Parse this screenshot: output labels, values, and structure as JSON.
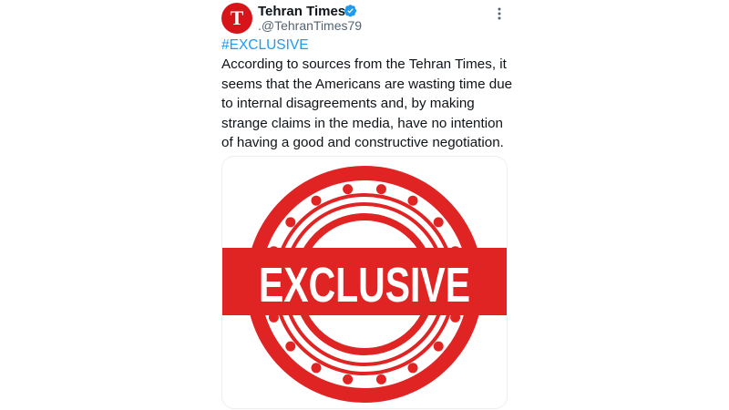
{
  "tweet": {
    "author_name": "Tehran Times",
    "author_handle": ".@TehranTimes79",
    "avatar_letter": "T",
    "hashtag": "#EXCLUSIVE",
    "text": "According to sources from the Tehran Times, it seems that the Americans are wasting time due to internal disagreements and, by making strange claims in the media, have no intention of having a good and constructive negotiation.",
    "media": {
      "stamp_text": "EXCLUSIVE",
      "stamp_color": "#e02424"
    }
  },
  "colors": {
    "accent": "#1d9bf0",
    "brand": "#d7141a"
  },
  "icons": [
    "verified-icon",
    "more-options-icon"
  ]
}
